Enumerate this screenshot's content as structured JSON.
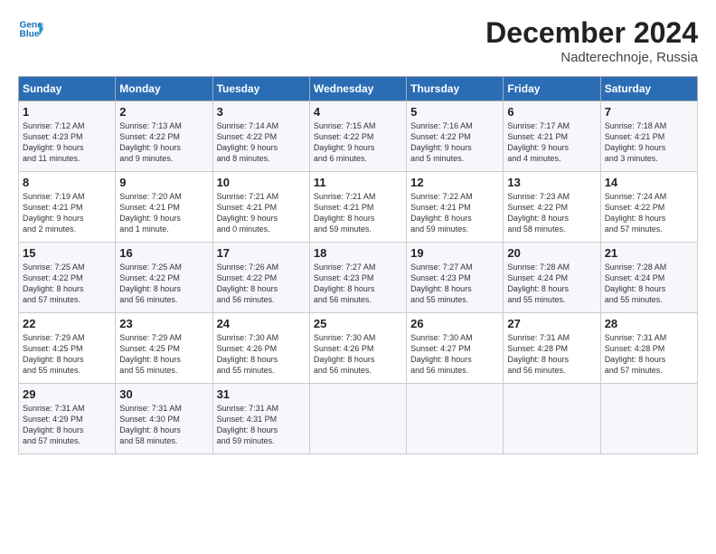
{
  "header": {
    "logo_line1": "General",
    "logo_line2": "Blue",
    "title": "December 2024",
    "subtitle": "Nadterechnoje, Russia"
  },
  "days_of_week": [
    "Sunday",
    "Monday",
    "Tuesday",
    "Wednesday",
    "Thursday",
    "Friday",
    "Saturday"
  ],
  "weeks": [
    [
      {
        "day": "1",
        "info": "Sunrise: 7:12 AM\nSunset: 4:23 PM\nDaylight: 9 hours\nand 11 minutes."
      },
      {
        "day": "2",
        "info": "Sunrise: 7:13 AM\nSunset: 4:22 PM\nDaylight: 9 hours\nand 9 minutes."
      },
      {
        "day": "3",
        "info": "Sunrise: 7:14 AM\nSunset: 4:22 PM\nDaylight: 9 hours\nand 8 minutes."
      },
      {
        "day": "4",
        "info": "Sunrise: 7:15 AM\nSunset: 4:22 PM\nDaylight: 9 hours\nand 6 minutes."
      },
      {
        "day": "5",
        "info": "Sunrise: 7:16 AM\nSunset: 4:22 PM\nDaylight: 9 hours\nand 5 minutes."
      },
      {
        "day": "6",
        "info": "Sunrise: 7:17 AM\nSunset: 4:21 PM\nDaylight: 9 hours\nand 4 minutes."
      },
      {
        "day": "7",
        "info": "Sunrise: 7:18 AM\nSunset: 4:21 PM\nDaylight: 9 hours\nand 3 minutes."
      }
    ],
    [
      {
        "day": "8",
        "info": "Sunrise: 7:19 AM\nSunset: 4:21 PM\nDaylight: 9 hours\nand 2 minutes."
      },
      {
        "day": "9",
        "info": "Sunrise: 7:20 AM\nSunset: 4:21 PM\nDaylight: 9 hours\nand 1 minute."
      },
      {
        "day": "10",
        "info": "Sunrise: 7:21 AM\nSunset: 4:21 PM\nDaylight: 9 hours\nand 0 minutes."
      },
      {
        "day": "11",
        "info": "Sunrise: 7:21 AM\nSunset: 4:21 PM\nDaylight: 8 hours\nand 59 minutes."
      },
      {
        "day": "12",
        "info": "Sunrise: 7:22 AM\nSunset: 4:21 PM\nDaylight: 8 hours\nand 59 minutes."
      },
      {
        "day": "13",
        "info": "Sunrise: 7:23 AM\nSunset: 4:22 PM\nDaylight: 8 hours\nand 58 minutes."
      },
      {
        "day": "14",
        "info": "Sunrise: 7:24 AM\nSunset: 4:22 PM\nDaylight: 8 hours\nand 57 minutes."
      }
    ],
    [
      {
        "day": "15",
        "info": "Sunrise: 7:25 AM\nSunset: 4:22 PM\nDaylight: 8 hours\nand 57 minutes."
      },
      {
        "day": "16",
        "info": "Sunrise: 7:25 AM\nSunset: 4:22 PM\nDaylight: 8 hours\nand 56 minutes."
      },
      {
        "day": "17",
        "info": "Sunrise: 7:26 AM\nSunset: 4:22 PM\nDaylight: 8 hours\nand 56 minutes."
      },
      {
        "day": "18",
        "info": "Sunrise: 7:27 AM\nSunset: 4:23 PM\nDaylight: 8 hours\nand 56 minutes."
      },
      {
        "day": "19",
        "info": "Sunrise: 7:27 AM\nSunset: 4:23 PM\nDaylight: 8 hours\nand 55 minutes."
      },
      {
        "day": "20",
        "info": "Sunrise: 7:28 AM\nSunset: 4:24 PM\nDaylight: 8 hours\nand 55 minutes."
      },
      {
        "day": "21",
        "info": "Sunrise: 7:28 AM\nSunset: 4:24 PM\nDaylight: 8 hours\nand 55 minutes."
      }
    ],
    [
      {
        "day": "22",
        "info": "Sunrise: 7:29 AM\nSunset: 4:25 PM\nDaylight: 8 hours\nand 55 minutes."
      },
      {
        "day": "23",
        "info": "Sunrise: 7:29 AM\nSunset: 4:25 PM\nDaylight: 8 hours\nand 55 minutes."
      },
      {
        "day": "24",
        "info": "Sunrise: 7:30 AM\nSunset: 4:26 PM\nDaylight: 8 hours\nand 55 minutes."
      },
      {
        "day": "25",
        "info": "Sunrise: 7:30 AM\nSunset: 4:26 PM\nDaylight: 8 hours\nand 56 minutes."
      },
      {
        "day": "26",
        "info": "Sunrise: 7:30 AM\nSunset: 4:27 PM\nDaylight: 8 hours\nand 56 minutes."
      },
      {
        "day": "27",
        "info": "Sunrise: 7:31 AM\nSunset: 4:28 PM\nDaylight: 8 hours\nand 56 minutes."
      },
      {
        "day": "28",
        "info": "Sunrise: 7:31 AM\nSunset: 4:28 PM\nDaylight: 8 hours\nand 57 minutes."
      }
    ],
    [
      {
        "day": "29",
        "info": "Sunrise: 7:31 AM\nSunset: 4:29 PM\nDaylight: 8 hours\nand 57 minutes."
      },
      {
        "day": "30",
        "info": "Sunrise: 7:31 AM\nSunset: 4:30 PM\nDaylight: 8 hours\nand 58 minutes."
      },
      {
        "day": "31",
        "info": "Sunrise: 7:31 AM\nSunset: 4:31 PM\nDaylight: 8 hours\nand 59 minutes."
      },
      {
        "day": "",
        "info": ""
      },
      {
        "day": "",
        "info": ""
      },
      {
        "day": "",
        "info": ""
      },
      {
        "day": "",
        "info": ""
      }
    ]
  ]
}
